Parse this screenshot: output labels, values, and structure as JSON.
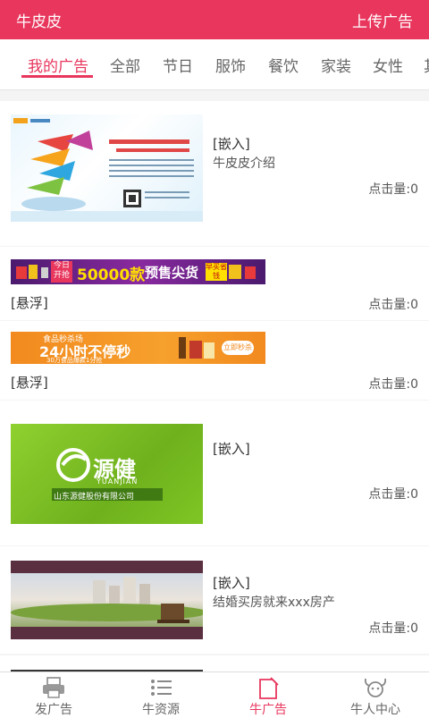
{
  "header": {
    "title": "牛皮皮",
    "upload": "上传广告"
  },
  "tabs": [
    "我的广告",
    "全部",
    "节日",
    "服饰",
    "餐饮",
    "家装",
    "女性",
    "其"
  ],
  "ads": [
    {
      "type": "[嵌入]",
      "desc": "牛皮皮介绍",
      "clicks": "点击量:0"
    },
    {
      "type": "[悬浮]",
      "clicks": "点击量:0",
      "banner_badge": "今日开抢",
      "banner_big": "50000款",
      "banner_text": "预售尖货",
      "banner_btn": "早买省钱"
    },
    {
      "type": "[悬浮]",
      "clicks": "点击量:0",
      "banner_top": "食品秒杀场",
      "banner_big": "24小时不停秒",
      "banner_sub": "30万食品爆款1分抢",
      "banner_btn": "立即秒杀"
    },
    {
      "type": "[嵌入]",
      "desc": "",
      "clicks": "点击量:0",
      "logo_cn": "源健",
      "logo_en": "YUANJIAN",
      "logo_co": "山东源健股份有限公司"
    },
    {
      "type": "[嵌入]",
      "desc": "结婚买房就来xxx房产",
      "clicks": "点击量:0"
    }
  ],
  "bottom_nav": [
    "发广告",
    "牛资源",
    "牛广告",
    "牛人中心"
  ],
  "colors": {
    "accent": "#e8365d"
  }
}
